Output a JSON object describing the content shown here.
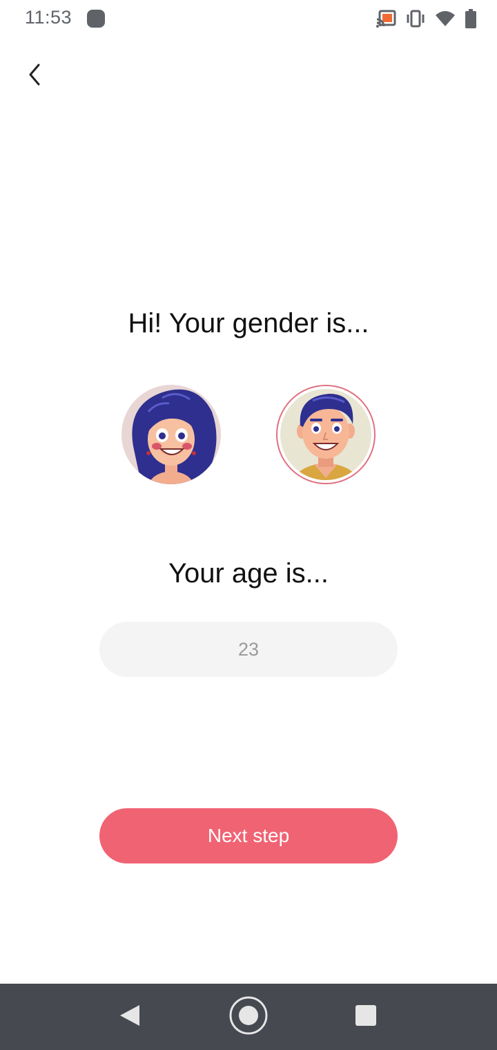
{
  "status_bar": {
    "time": "11:53",
    "icons": [
      "record-dot-icon",
      "cast-icon",
      "vibrate-icon",
      "wifi-icon",
      "battery-icon"
    ]
  },
  "header": {
    "back_icon": "chevron-left-icon"
  },
  "gender_section": {
    "title": "Hi! Your gender is...",
    "options": [
      {
        "id": "female",
        "icon": "female-avatar-icon",
        "selected": false
      },
      {
        "id": "male",
        "icon": "male-avatar-icon",
        "selected": true
      }
    ]
  },
  "age_section": {
    "title": "Your age is...",
    "value": "23"
  },
  "next_button": {
    "label": "Next step"
  },
  "navigation_bar": {
    "icons": [
      "nav-back-icon",
      "nav-home-icon",
      "nav-recents-icon"
    ]
  },
  "colors": {
    "accent": "#f06373",
    "nav_bar": "#464a50",
    "input_bg": "#f4f4f4",
    "avatar_hair": "#2e2f8f",
    "skin": "#f2ad8e"
  }
}
